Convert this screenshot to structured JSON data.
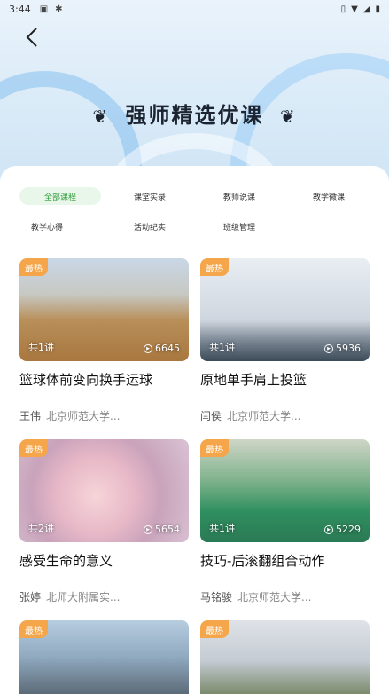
{
  "status_bar": {
    "time": "3:44",
    "icons": [
      "notification-a-icon",
      "bug-icon"
    ],
    "right_icons": [
      "vibrate-icon",
      "wifi-icon",
      "signal-icon",
      "battery-icon"
    ]
  },
  "header": {
    "back_icon": "back-arrow-icon",
    "title": "强师精选优课"
  },
  "tabs": [
    {
      "label": "全部课程",
      "active": true
    },
    {
      "label": "课堂实录",
      "active": false
    },
    {
      "label": "教师说课",
      "active": false
    },
    {
      "label": "教学微课",
      "active": false
    },
    {
      "label": "教学心得",
      "active": false
    },
    {
      "label": "活动纪实",
      "active": false
    },
    {
      "label": "班级管理",
      "active": false
    }
  ],
  "courses": [
    {
      "badge": "最热",
      "lessons": "共1讲",
      "views": "6645",
      "title": "篮球体前变向换手运球",
      "teacher": "王伟",
      "school": "北京师范大学..."
    },
    {
      "badge": "最热",
      "lessons": "共1讲",
      "views": "5936",
      "title": "原地单手肩上投篮",
      "teacher": "闫侯",
      "school": "北京师范大学..."
    },
    {
      "badge": "最热",
      "lessons": "共2讲",
      "views": "5654",
      "title": "感受生命的意义",
      "teacher": "张婷",
      "school": "北师大附属实..."
    },
    {
      "badge": "最热",
      "lessons": "共1讲",
      "views": "5229",
      "title": "技巧-后滚翻组合动作",
      "teacher": "马铭骏",
      "school": "北京师范大学..."
    },
    {
      "badge": "最热"
    },
    {
      "badge": "最热"
    }
  ],
  "colors": {
    "accent_green": "#2f9b3a",
    "badge_orange": "#f5a64a"
  }
}
